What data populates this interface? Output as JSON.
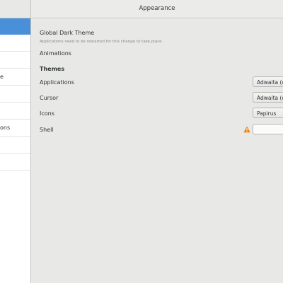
{
  "window": {
    "title": "Appearance"
  },
  "sidebar": {
    "items": [
      {
        "label": "",
        "selected": true
      },
      {
        "label": ""
      },
      {
        "label": ""
      },
      {
        "label": "e"
      },
      {
        "label": ""
      },
      {
        "label": "ons"
      },
      {
        "label": ""
      },
      {
        "label": ""
      },
      {
        "label": ""
      }
    ]
  },
  "appearance": {
    "dark_theme_label": "Global Dark Theme",
    "dark_theme_note": "Applications need to be restarted for this change to take place.",
    "animations_label": "Animations",
    "themes_heading": "Themes",
    "rows": {
      "applications": {
        "label": "Applications",
        "value": "Adwaita (d"
      },
      "cursor": {
        "label": "Cursor",
        "value": "Adwaita (d"
      },
      "icons": {
        "label": "Icons",
        "value": "Papirus"
      },
      "shell": {
        "label": "Shell",
        "value": ""
      }
    }
  },
  "colors": {
    "accent": "#4a90d9",
    "warning": "#f57900"
  }
}
